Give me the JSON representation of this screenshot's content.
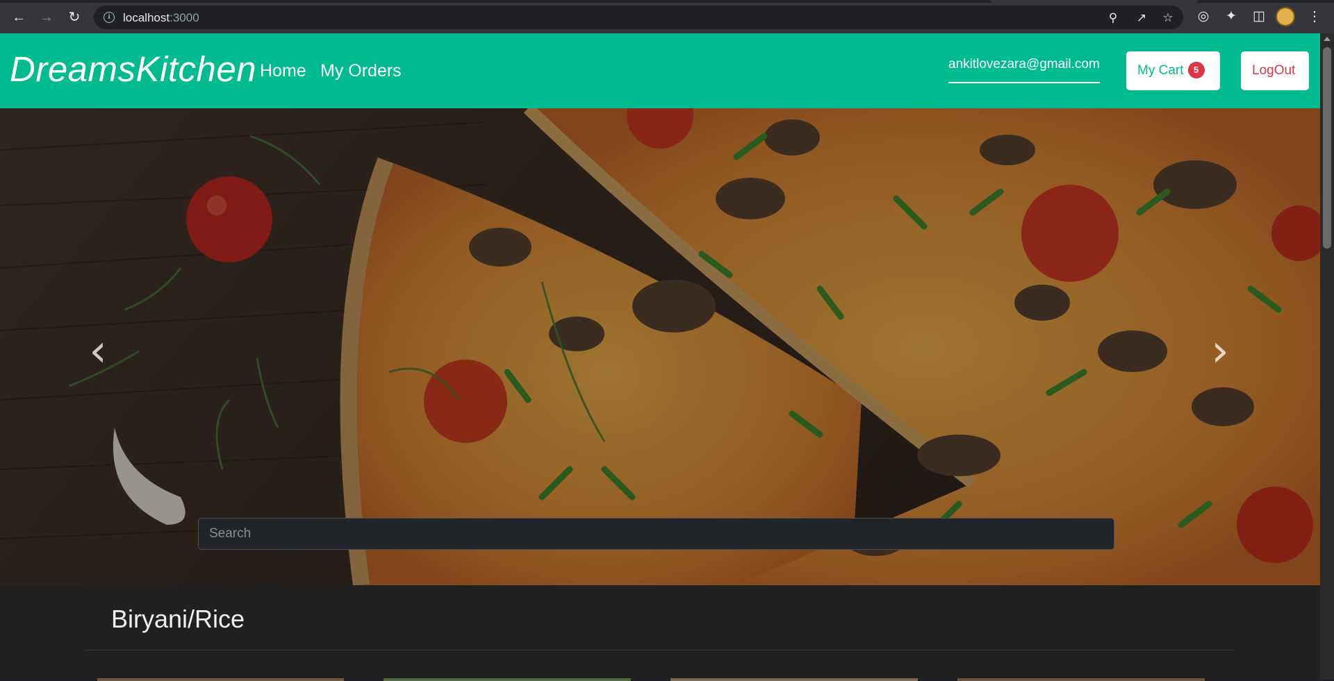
{
  "browser": {
    "url_host": "localhost",
    "url_port": ":3000",
    "icons": [
      "back-icon",
      "forward-icon",
      "reload-icon",
      "info-icon",
      "key-icon",
      "share-icon",
      "star-icon",
      "cast-icon",
      "extensions-icon",
      "sidepanel-icon",
      "profile-avatar",
      "menu-icon"
    ]
  },
  "navbar": {
    "brand": "DreamsKitchen",
    "links": [
      {
        "label": "Home"
      },
      {
        "label": "My Orders"
      }
    ],
    "user_email": "ankitlovezara@gmail.com",
    "cart_label": "My Cart",
    "cart_count": "5",
    "logout_label": "LogOut",
    "accent_color": "#00bb8f"
  },
  "carousel": {
    "prev_symbol": "‹",
    "next_symbol": "›",
    "search_placeholder": "Search"
  },
  "main": {
    "section_title": "Biryani/Rice"
  }
}
